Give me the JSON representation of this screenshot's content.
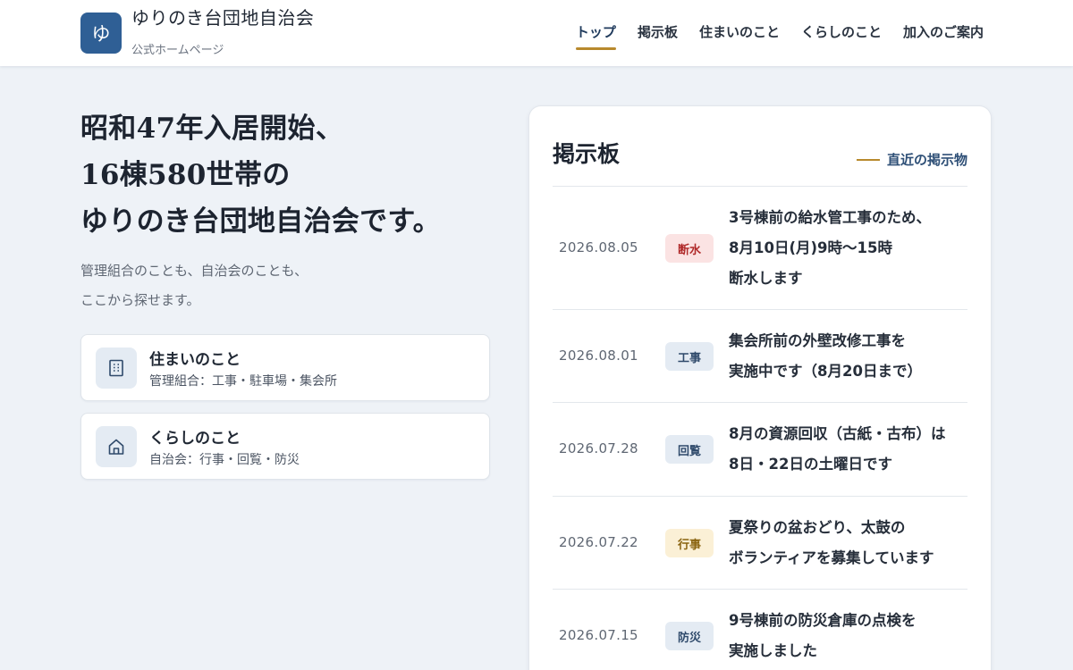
{
  "header": {
    "logo_char": "ゆ",
    "title": "ゆりのき台団地自治会",
    "subtitle": "公式ホームページ"
  },
  "nav": {
    "items": [
      {
        "label": "トップ",
        "active": true
      },
      {
        "label": "掲示板"
      },
      {
        "label": "住まいのこと"
      },
      {
        "label": "くらしのこと"
      },
      {
        "label": "加入のご案内"
      }
    ]
  },
  "hero": {
    "lines": [
      "昭和47年入居開始、",
      "16棟580世帯の",
      "ゆりのき台団地自治会です。"
    ],
    "sub_lines": [
      "管理組合のことも、自治会のことも、",
      "ここから探せます。"
    ]
  },
  "cards": [
    {
      "icon": "building-icon",
      "title": "住まいのこと",
      "desc": "管理組合：工事・駐車場・集会所"
    },
    {
      "icon": "house-icon",
      "title": "くらしのこと",
      "desc": "自治会：行事・回覧・防災"
    }
  ],
  "board": {
    "title": "掲示板",
    "link_label": "直近の掲示物",
    "posts": [
      {
        "date": "2026.08.05",
        "tag": "断水",
        "lines": [
          "3号棟前の給水管工事のため、",
          "8月10日(月)9時〜15時",
          "断水します"
        ]
      },
      {
        "date": "2026.08.01",
        "tag": "工事",
        "lines": [
          "集会所前の外壁改修工事を",
          "実施中です（8月20日まで）"
        ]
      },
      {
        "date": "2026.07.28",
        "tag": "回覧",
        "lines": [
          "8月の資源回収（古紙・古布）は",
          "8日・22日の土曜日です"
        ]
      },
      {
        "date": "2026.07.22",
        "tag": "行事",
        "lines": [
          "夏祭りの盆おどり、太鼓の",
          "ボランティアを募集しています"
        ]
      },
      {
        "date": "2026.07.15",
        "tag": "防災",
        "lines": [
          "9号棟前の防災倉庫の点検を",
          "実施しました"
        ]
      }
    ]
  },
  "colors": {
    "brand": "#2f5f95",
    "accent": "#b8892d",
    "tag_outage_bg": "#fbe3e3",
    "tag_outage_fg": "#b02a2a",
    "tag_event_bg": "#fbf0d6",
    "tag_event_fg": "#8a6410",
    "tag_default_bg": "#e4ebf3",
    "tag_default_fg": "#2f4a6b"
  }
}
